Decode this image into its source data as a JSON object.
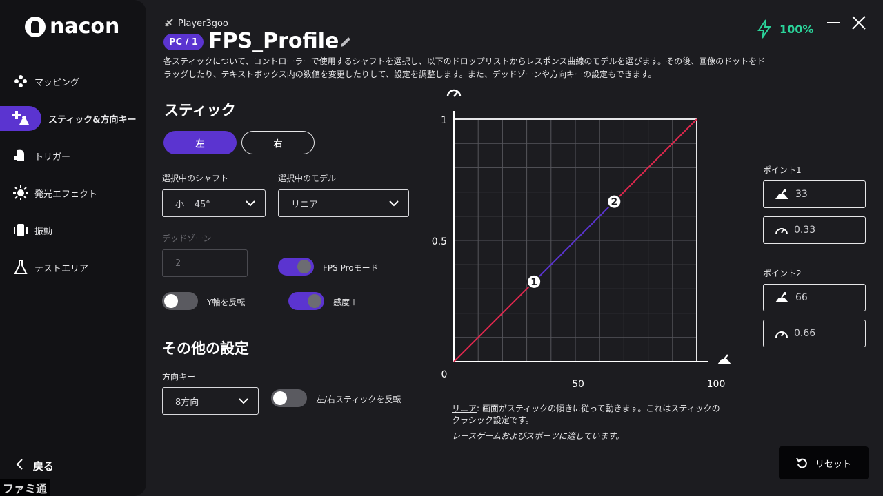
{
  "sidebar": {
    "logo_text": "nacon",
    "items": [
      {
        "label": "マッピング",
        "icon": "gamepad-buttons-icon"
      },
      {
        "label": "スティック&方向キー",
        "icon": "stick-dpad-icon"
      },
      {
        "label": "トリガー",
        "icon": "trigger-icon"
      },
      {
        "label": "発光エフェクト",
        "icon": "light-effect-icon"
      },
      {
        "label": "振動",
        "icon": "vibration-icon"
      },
      {
        "label": "テストエリア",
        "icon": "flask-icon"
      }
    ],
    "active_index": 1,
    "back_label": "戻る"
  },
  "header": {
    "player": "Player3goo",
    "pc_badge": "PC / 1",
    "profile_name": "FPS_Profile",
    "description": "各スティックについて、コントローラーで使用するシャフトを選択し、以下のドロップリストからレスポンス曲線のモデルを選びます。その後、画像のドットをドラッグしたり、テキストボックス内の数値を変更したりして、設定を調整します。また、デッドゾーンや方向キーの設定もできます。",
    "battery": "100%",
    "accent_color": "#5b34d0",
    "battery_color": "#2bd39a"
  },
  "stick": {
    "heading": "スティック",
    "left_label": "左",
    "right_label": "右",
    "shaft_label": "選択中のシャフト",
    "shaft_value": "小 – 45°",
    "model_label": "選択中のモデル",
    "model_value": "リニア",
    "deadzone_label": "デッドゾーン",
    "deadzone_value": "2",
    "fps_pro_label": "FPS Proモード",
    "fps_pro_on": true,
    "invert_y_label": "Y軸を反転",
    "invert_y_on": false,
    "sensitivity_label": "感度＋",
    "sensitivity_on": true
  },
  "other": {
    "heading": "その他の設定",
    "dpad_label": "方向キー",
    "dpad_value": "8方向",
    "swap_label": "左/右スティックを反転",
    "swap_on": false
  },
  "chart_data": {
    "type": "line",
    "x": [
      0,
      33,
      66,
      100
    ],
    "y": [
      0,
      0.33,
      0.66,
      1
    ],
    "xlim": [
      0,
      100
    ],
    "ylim": [
      0,
      1
    ],
    "x_ticks": [
      "0",
      "50",
      "100"
    ],
    "y_ticks": [
      "0.5",
      "1"
    ],
    "points": [
      {
        "label": "1",
        "x": 33,
        "y": 0.33
      },
      {
        "label": "2",
        "x": 66,
        "y": 0.66
      }
    ],
    "grid": true,
    "line_color": "#e0284e",
    "mid_color": "#5b34d0"
  },
  "curve_info": {
    "model_name": "リニア",
    "desc": ": 画面がスティックの傾きに従って動きます。これはスティックのクラシック設定です。",
    "note": "レースゲームおよびスポーツに適しています。"
  },
  "points_panel": {
    "point1_label": "ポイント1",
    "point1_x": "33",
    "point1_y": "0.33",
    "point2_label": "ポイント2",
    "point2_x": "66",
    "point2_y": "0.66"
  },
  "reset_label": "リセット",
  "watermark": "ファミ通"
}
